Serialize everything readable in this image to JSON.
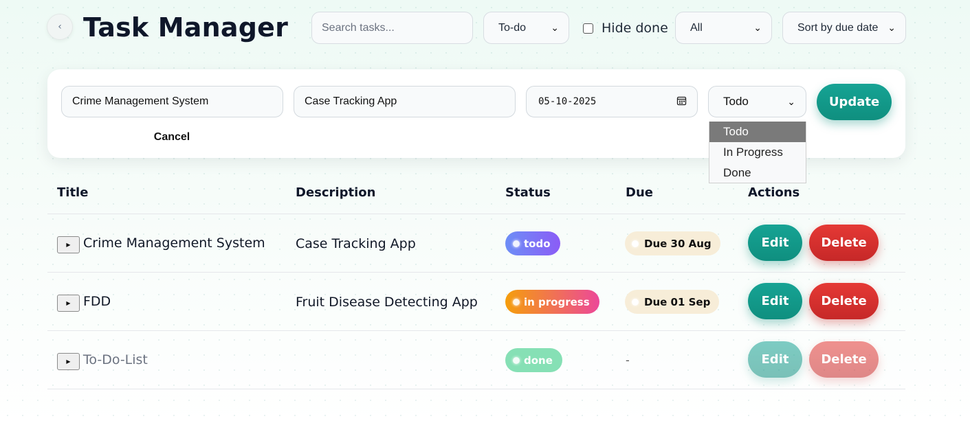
{
  "header": {
    "back_icon": "chevron-left-icon",
    "back_glyph": "‹",
    "title": "Task Manager",
    "search_placeholder": "Search tasks...",
    "status_filter": "To-do",
    "hide_done_label": "Hide done",
    "hide_done_checked": false,
    "category_filter": "All",
    "sort": "Sort by due date"
  },
  "edit_form": {
    "title_value": "Crime Management System",
    "description_value": "Case Tracking App",
    "due_date_value": "05-10-2025",
    "calendar_icon": "calendar-icon",
    "status_value": "Todo",
    "status_options": [
      "Todo",
      "In Progress",
      "Done"
    ],
    "status_options_highlighted": "Todo",
    "update_label": "Update",
    "cancel_label": "Cancel"
  },
  "table": {
    "columns": [
      "Title",
      "Description",
      "Status",
      "Due",
      "Actions"
    ],
    "rows": [
      {
        "title": "Crime Management System",
        "description": "Case Tracking App",
        "status": "todo",
        "due": "Due 30 Aug",
        "edit_label": "Edit",
        "delete_label": "Delete",
        "done": false
      },
      {
        "title": "FDD",
        "description": "Fruit Disease Detecting App",
        "status": "in progress",
        "due": "Due 01 Sep",
        "edit_label": "Edit",
        "delete_label": "Delete",
        "done": false
      },
      {
        "title": "To-Do-List",
        "description": "",
        "status": "done",
        "due": "-",
        "edit_label": "Edit",
        "delete_label": "Delete",
        "done": true
      }
    ]
  },
  "colors": {
    "accent_teal": "#0f8f7f",
    "danger_red": "#c62828",
    "todo_badge": "#8b5cf6",
    "progress_badge": "#ec4899",
    "done_badge": "#86e0b5",
    "due_badge": "#f7edd8"
  }
}
